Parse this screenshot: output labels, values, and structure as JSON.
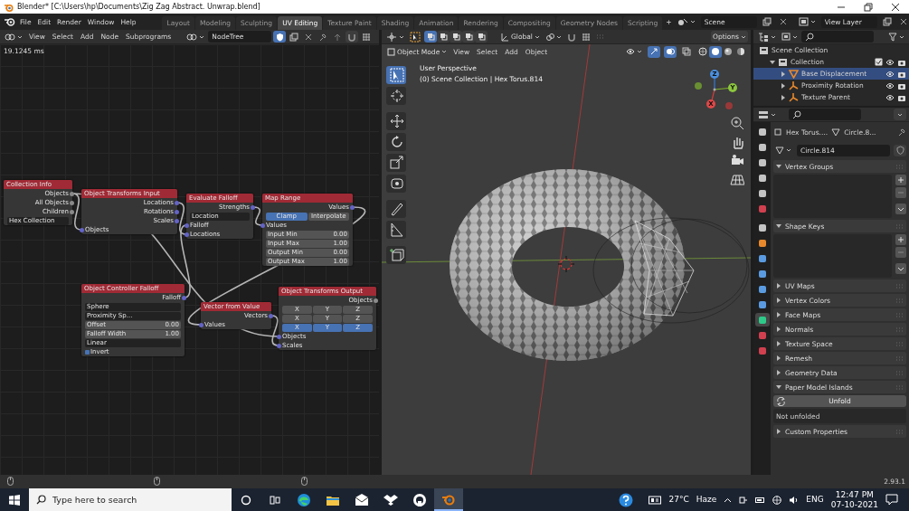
{
  "window": {
    "title": "Blender* [C:\\Users\\hp\\Documents\\Zig Zag Abstract. Unwrap.blend]"
  },
  "menu": [
    "File",
    "Edit",
    "Render",
    "Window",
    "Help"
  ],
  "workspaces": [
    {
      "label": "Layout",
      "selected": false
    },
    {
      "label": "Modeling",
      "selected": false
    },
    {
      "label": "Sculpting",
      "selected": false
    },
    {
      "label": "UV Editing",
      "selected": true
    },
    {
      "label": "Texture Paint",
      "selected": false
    },
    {
      "label": "Shading",
      "selected": false
    },
    {
      "label": "Animation",
      "selected": false
    },
    {
      "label": "Rendering",
      "selected": false
    },
    {
      "label": "Compositing",
      "selected": false
    },
    {
      "label": "Geometry Nodes",
      "selected": false
    },
    {
      "label": "Scripting",
      "selected": false
    }
  ],
  "add_workspace": "+",
  "scene": "Scene",
  "view_layer": "View Layer",
  "node_editor": {
    "menu": [
      "View",
      "Select",
      "Add",
      "Node",
      "Subprograms"
    ],
    "tree": "NodeTree",
    "timing": "19.1245 ms",
    "nodes": [
      {
        "title": "Collection Info",
        "rows": [
          {
            "kind": "out",
            "label": "Objects"
          },
          {
            "kind": "out",
            "label": "All Objects"
          },
          {
            "kind": "out",
            "label": "Children"
          },
          {
            "kind": "field",
            "label": "Hex Collection"
          }
        ]
      },
      {
        "title": "Object Transforms Input",
        "rows": [
          {
            "kind": "out",
            "label": "Locations"
          },
          {
            "kind": "out",
            "label": "Rotations"
          },
          {
            "kind": "out",
            "label": "Scales"
          },
          {
            "kind": "in",
            "label": "Objects"
          }
        ]
      },
      {
        "title": "Evaluate Falloff",
        "rows": [
          {
            "kind": "out",
            "label": "Strengths"
          },
          {
            "kind": "field",
            "label": "Location"
          },
          {
            "kind": "in",
            "label": "Falloff"
          },
          {
            "kind": "in",
            "label": "Locations"
          }
        ]
      },
      {
        "title": "Map Range",
        "rows": [
          {
            "kind": "out",
            "label": "Values"
          },
          {
            "kind": "toggle",
            "options": [
              {
                "label": "Clamp",
                "selected": true
              },
              {
                "label": "Interpolate",
                "selected": false
              }
            ]
          },
          {
            "kind": "in",
            "label": "Values"
          },
          {
            "kind": "value",
            "label": "Input Min",
            "value": "0.00"
          },
          {
            "kind": "value",
            "label": "Input Max",
            "value": "1.00"
          },
          {
            "kind": "value",
            "label": "Output Min",
            "value": "0.00"
          },
          {
            "kind": "value",
            "label": "Output Max",
            "value": "1.00"
          }
        ]
      },
      {
        "title": "Object Controller Falloff",
        "rows": [
          {
            "kind": "out",
            "label": "Falloff"
          },
          {
            "kind": "field",
            "label": "Sphere"
          },
          {
            "kind": "field",
            "label": "Proximity Sp..."
          },
          {
            "kind": "value",
            "label": "Offset",
            "value": "0.00"
          },
          {
            "kind": "value",
            "label": "Falloff Width",
            "value": "1.00"
          },
          {
            "kind": "field",
            "label": "Linear"
          },
          {
            "kind": "check",
            "label": "Invert",
            "checked": true
          }
        ]
      },
      {
        "title": "Vector from Value",
        "rows": [
          {
            "kind": "out",
            "label": "Vectors"
          },
          {
            "kind": "in",
            "label": "Values"
          }
        ]
      },
      {
        "title": "Object Transforms Output",
        "rows": [
          {
            "kind": "out",
            "label": "Objects"
          },
          {
            "kind": "toggle",
            "options": [
              {
                "label": "X",
                "selected": false
              },
              {
                "label": "Y",
                "selected": false
              },
              {
                "label": "Z",
                "selected": false
              }
            ]
          },
          {
            "kind": "toggle",
            "options": [
              {
                "label": "X",
                "selected": false
              },
              {
                "label": "Y",
                "selected": false
              },
              {
                "label": "Z",
                "selected": false
              }
            ]
          },
          {
            "kind": "toggle",
            "options": [
              {
                "label": "X",
                "selected": true
              },
              {
                "label": "Y",
                "selected": true
              },
              {
                "label": "Z",
                "selected": true
              }
            ]
          },
          {
            "kind": "in",
            "label": "Objects"
          },
          {
            "kind": "in",
            "label": "Scales"
          }
        ]
      }
    ]
  },
  "viewport": {
    "orientation": "Global",
    "options": "Options",
    "mode": "Object Mode",
    "menu": [
      "View",
      "Select",
      "Add",
      "Object"
    ],
    "view_name": "User Perspective",
    "context": "(0) Scene Collection | Hex Torus.814",
    "tools": [
      {
        "selected": true
      },
      {
        "selected": false
      },
      {
        "selected": false
      },
      {
        "selected": false
      },
      {
        "selected": false
      },
      {
        "selected": false
      },
      {
        "selected": false
      },
      {
        "selected": false
      },
      {
        "selected": false
      }
    ],
    "shading": [
      {
        "selected": false
      },
      {
        "selected": true
      },
      {
        "selected": false
      },
      {
        "selected": false
      }
    ],
    "gizmo_axes": [
      "Z",
      "Y",
      "X"
    ]
  },
  "outliner": {
    "items": [
      {
        "label": "Scene Collection",
        "kind": "collection",
        "selected": false,
        "children": [
          {
            "label": "Collection",
            "kind": "collection",
            "selected": false,
            "expanded": true,
            "checked": true,
            "children": [
              {
                "label": "Base Displacement",
                "kind": "mesh",
                "selected": true,
                "expanded": false
              },
              {
                "label": "Proximity Rotation",
                "kind": "empty",
                "selected": false,
                "expanded": false
              },
              {
                "label": "Texture Parent",
                "kind": "empty",
                "selected": false,
                "expanded": false
              }
            ]
          }
        ]
      }
    ]
  },
  "properties": {
    "tabs": [
      {
        "color": "#c4c4c4",
        "selected": false
      },
      {
        "color": "#c4c4c4",
        "selected": false
      },
      {
        "color": "#c4c4c4",
        "selected": false
      },
      {
        "color": "#c4c4c4",
        "selected": false
      },
      {
        "color": "#c4c4c4",
        "selected": false
      },
      {
        "color": "#d0404f",
        "selected": false
      },
      {
        "color": "#c4c4c4",
        "selected": false
      },
      {
        "color": "#e8882c",
        "selected": false
      },
      {
        "color": "#5a9ae0",
        "selected": false
      },
      {
        "color": "#5a9ae0",
        "selected": false
      },
      {
        "color": "#5a9ae0",
        "selected": false
      },
      {
        "color": "#5a9ae0",
        "selected": false
      },
      {
        "color": "#2fc98a",
        "selected": true
      },
      {
        "color": "#d0404f",
        "selected": false
      },
      {
        "color": "#d0404f",
        "selected": false
      }
    ],
    "object": "Hex Torus....",
    "data": "Circle.8...",
    "mesh": "Circle.814",
    "panels": [
      {
        "title": "Vertex Groups",
        "kind": "list",
        "expanded": true
      },
      {
        "title": "Shape Keys",
        "kind": "list",
        "expanded": true
      },
      {
        "title": "UV Maps",
        "expanded": false
      },
      {
        "title": "Vertex Colors",
        "expanded": false
      },
      {
        "title": "Face Maps",
        "expanded": false
      },
      {
        "title": "Normals",
        "expanded": false
      },
      {
        "title": "Texture Space",
        "expanded": false
      },
      {
        "title": "Remesh",
        "expanded": false
      },
      {
        "title": "Geometry Data",
        "expanded": false
      },
      {
        "title": "Paper Model Islands",
        "kind": "unfold",
        "expanded": true,
        "button": "Unfold",
        "note": "Not unfolded"
      },
      {
        "title": "Custom Properties",
        "expanded": false
      }
    ]
  },
  "status": {
    "version": "2.93.1"
  },
  "taskbar": {
    "search_placeholder": "Type here to search",
    "apps": [
      {
        "selected": false
      },
      {
        "selected": false
      },
      {
        "selected": false
      },
      {
        "selected": false
      },
      {
        "selected": false
      },
      {
        "selected": true
      }
    ],
    "temperature": "27°C",
    "weather": "Haze",
    "language": "ENG",
    "time": "12:47 PM",
    "date": "07-10-2021"
  }
}
